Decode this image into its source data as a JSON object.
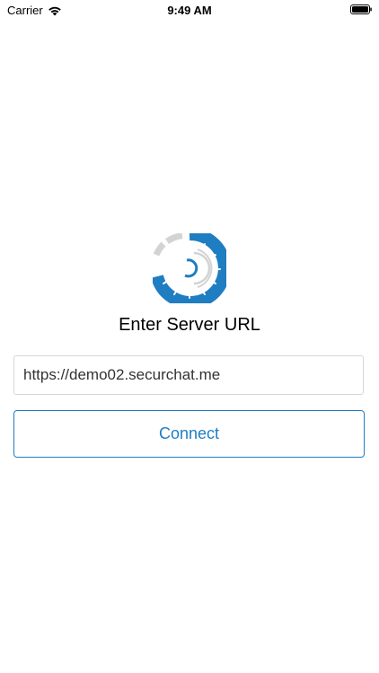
{
  "status_bar": {
    "carrier": "Carrier",
    "time": "9:49 AM",
    "icons": [
      "wifi-icon",
      "battery-icon"
    ]
  },
  "logo": {
    "icon": "securchat-logo",
    "colors": {
      "primary": "#1f7dc2",
      "secondary": "#d3d3d3"
    }
  },
  "form": {
    "heading": "Enter Server URL",
    "url_value": "https://demo02.securchat.me",
    "connect_label": "Connect"
  },
  "colors": {
    "accent": "#1f7dc2",
    "input_border": "#d6d6d6",
    "background": "#ffffff"
  }
}
